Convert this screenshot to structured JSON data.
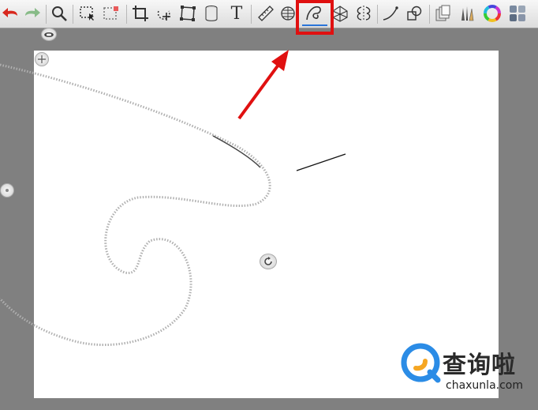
{
  "toolbar": {
    "tools": [
      {
        "icon": "undo-icon"
      },
      {
        "icon": "redo-icon"
      },
      {
        "icon": "zoom-icon"
      },
      {
        "icon": "selection-icon"
      },
      {
        "icon": "selection-options-icon"
      },
      {
        "icon": "crop-icon"
      },
      {
        "icon": "transform-icon"
      },
      {
        "icon": "distort-icon"
      },
      {
        "icon": "cylinder-icon"
      },
      {
        "icon": "text-icon",
        "label": "T"
      },
      {
        "icon": "ruler-icon"
      },
      {
        "icon": "ellipse-guide-icon"
      },
      {
        "icon": "french-curve-icon",
        "active": true
      },
      {
        "icon": "perspective-icon"
      },
      {
        "icon": "symmetry-icon"
      },
      {
        "icon": "stroke-icon"
      },
      {
        "icon": "shape-icon"
      },
      {
        "icon": "layers-icon"
      },
      {
        "icon": "brushes-icon"
      },
      {
        "icon": "color-wheel-icon"
      },
      {
        "icon": "palette-icon"
      }
    ],
    "accent_color": "#e01010",
    "active_color": "#2a74d8"
  },
  "watermark": {
    "title": "查询啦",
    "url": "chaxunla.com"
  }
}
